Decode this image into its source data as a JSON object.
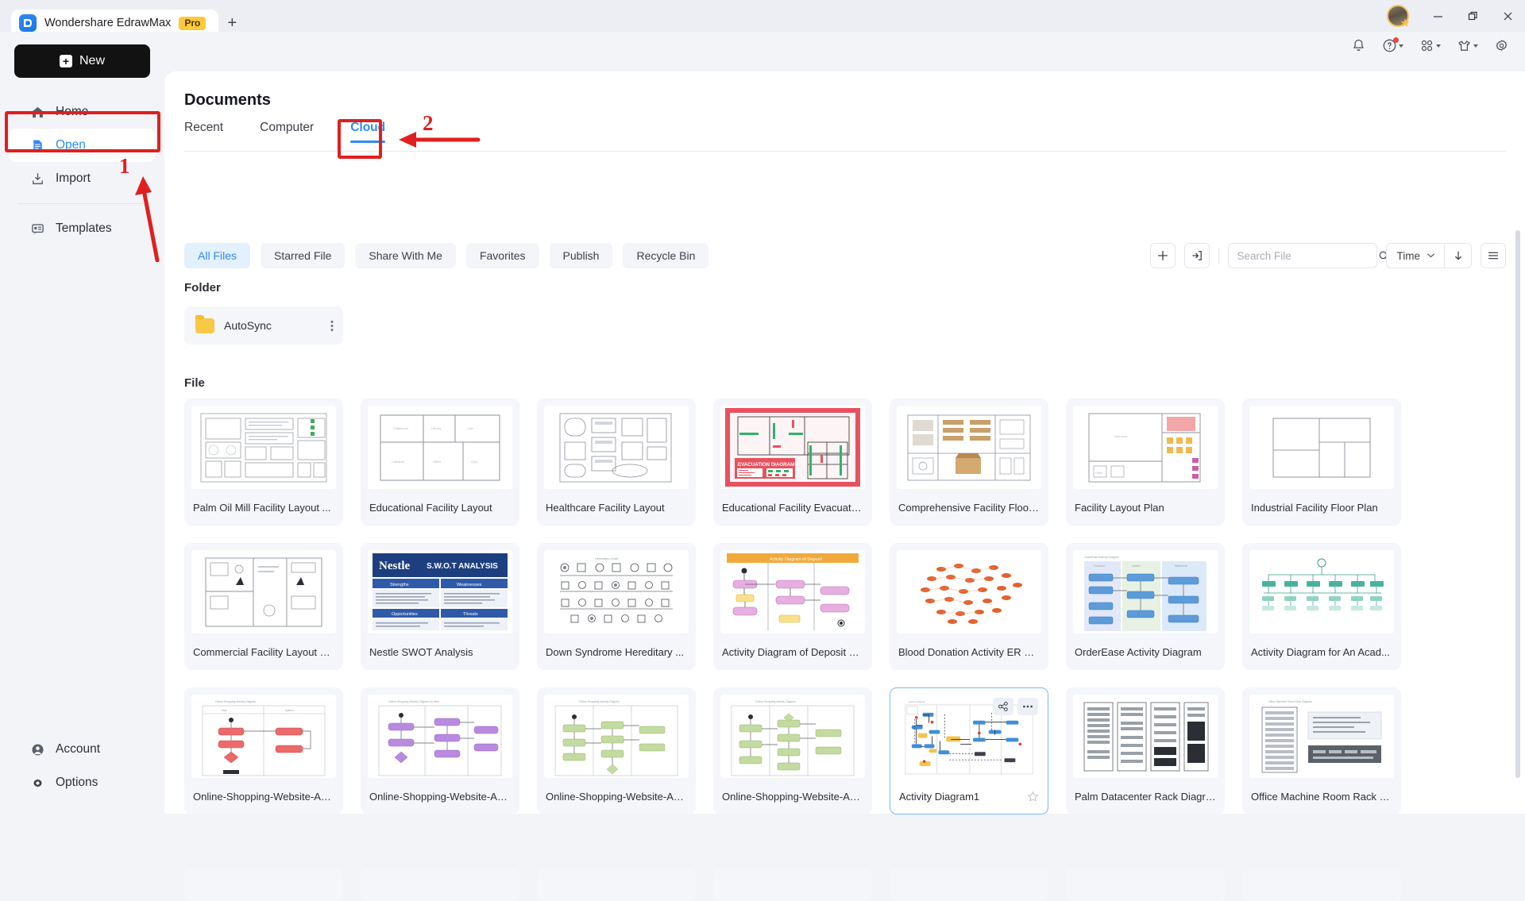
{
  "window": {
    "tab_title": "Wondershare EdrawMax",
    "pro_badge": "Pro",
    "new_tab_label": "+",
    "minimize": "—",
    "maximize": "❐",
    "close": "✕"
  },
  "header_icons": [
    {
      "name": "notification-bell-icon",
      "glyph": "🔔",
      "badge": false
    },
    {
      "name": "help-icon",
      "glyph": "?",
      "badge": true
    },
    {
      "name": "apps-grid-icon",
      "glyph": "∷",
      "badge": false
    },
    {
      "name": "theme-shirt-icon",
      "glyph": "👕",
      "badge": false
    },
    {
      "name": "settings-gear-icon",
      "glyph": "⚙",
      "badge": false
    }
  ],
  "sidebar": {
    "new_button": "New",
    "items": [
      {
        "label": "Home",
        "icon": "home-icon",
        "active": false
      },
      {
        "label": "Open",
        "icon": "open-document-icon",
        "active": true
      },
      {
        "label": "Import",
        "icon": "import-icon",
        "active": false
      },
      {
        "label": "Templates",
        "icon": "templates-icon",
        "active": false
      }
    ],
    "bottom_items": [
      {
        "label": "Account",
        "icon": "account-icon"
      },
      {
        "label": "Options",
        "icon": "options-gear-icon"
      }
    ]
  },
  "annotations": [
    {
      "number": "1",
      "target": "sidebar-open-item",
      "color": "#e01f1f"
    },
    {
      "number": "2",
      "target": "cloud-tab",
      "color": "#e01f1f"
    }
  ],
  "main": {
    "title": "Documents",
    "tabs": [
      {
        "label": "Recent",
        "selected": false
      },
      {
        "label": "Computer",
        "selected": false
      },
      {
        "label": "Cloud",
        "selected": true
      }
    ],
    "filters": [
      {
        "label": "All Files",
        "active": true
      },
      {
        "label": "Starred File",
        "active": false
      },
      {
        "label": "Share With Me",
        "active": false
      },
      {
        "label": "Favorites",
        "active": false
      },
      {
        "label": "Publish",
        "active": false
      },
      {
        "label": "Recycle Bin",
        "active": false
      }
    ],
    "tools": {
      "add_icon": "plus-icon",
      "upload_icon": "upload-to-cloud-icon",
      "search_placeholder": "Search File",
      "search_value": "",
      "search_icon": "search-icon",
      "sort_label": "Time",
      "sort_caret_icon": "chevron-down-icon",
      "sort_direction_icon": "arrow-down-icon",
      "list_view_icon": "list-view-icon"
    },
    "folder_section_title": "Folder",
    "folders": [
      {
        "name": "AutoSync",
        "icon": "folder-icon",
        "menu_icon": "more-vertical-icon"
      }
    ],
    "file_section_title": "File",
    "files": [
      {
        "name": "Palm Oil Mill Facility Layout ...",
        "art": "floorplan-dense",
        "selected": false
      },
      {
        "name": "Educational Facility Layout",
        "art": "floorplan-rooms",
        "selected": false
      },
      {
        "name": "Healthcare Facility Layout",
        "art": "floorplan-clinic",
        "selected": false
      },
      {
        "name": "Educational Facility Evacuatio...",
        "art": "evacuation",
        "selected": false
      },
      {
        "name": "Comprehensive Facility Floor ...",
        "art": "floorplan-wide",
        "selected": false
      },
      {
        "name": "Facility Layout Plan",
        "art": "floorplan-color",
        "selected": false
      },
      {
        "name": "Industrial Facility Floor Plan",
        "art": "floorplan-simple",
        "selected": false
      },
      {
        "name": "Commercial Facility Layout Pl...",
        "art": "floorplan-commercial",
        "selected": false
      },
      {
        "name": "Nestle SWOT Analysis",
        "art": "swot",
        "selected": false
      },
      {
        "name": "Down Syndrome Hereditary ...",
        "art": "genetic-tree",
        "selected": false
      },
      {
        "name": "Activity Diagram of Deposit S...",
        "art": "activity-orange",
        "selected": false
      },
      {
        "name": "Blood Donation Activity ER D...",
        "art": "scatter-orange",
        "selected": false
      },
      {
        "name": "OrderEase Activity Diagram",
        "art": "swimlane-blue",
        "selected": false
      },
      {
        "name": "Activity Diagram for An Acad...",
        "art": "org-green",
        "selected": false
      },
      {
        "name": "Online-Shopping-Website-Ac...",
        "art": "flow-red",
        "selected": false
      },
      {
        "name": "Online-Shopping-Website-Ac...",
        "art": "flow-purple",
        "selected": false
      },
      {
        "name": "Online-Shopping-Website-Ac...",
        "art": "flow-green",
        "selected": false
      },
      {
        "name": "Online-Shopping-Website-Ac...",
        "art": "flow-green2",
        "selected": false
      },
      {
        "name": "Activity Diagram1",
        "art": "activity-selected",
        "selected": true,
        "star_icon": "star-outline-icon",
        "share_icon": "share-icon",
        "more_icon": "more-horizontal-icon"
      },
      {
        "name": "Palm Datacenter Rack Diagram",
        "art": "rack",
        "selected": false
      },
      {
        "name": "Office Machine Room Rack D...",
        "art": "rack-office",
        "selected": false
      }
    ]
  },
  "colors": {
    "accent": "#2f8bf5",
    "annotation": "#e01f1f",
    "pro_badge": "#ffc93c",
    "app_bg": "#f3f4f8",
    "panel_bg": "#ffffff",
    "card_bg": "#f4f6fa"
  }
}
